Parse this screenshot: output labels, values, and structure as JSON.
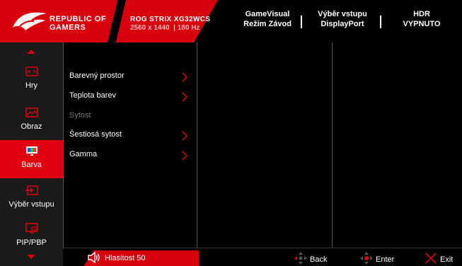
{
  "header": {
    "brand_line1": "REPUBLIC OF",
    "brand_line2": "GAMERS",
    "model": "ROG STRIX XG32WCS",
    "resolution": "2560 x 1440  | 180 Hz",
    "gamevisual_label": "GameVisual",
    "gamevisual_value": "Režim Závod",
    "input_label": "Výběr vstupu",
    "input_value": "DisplayPort",
    "hdr_label": "HDR",
    "hdr_value": "VYPNUTO"
  },
  "sidebar": {
    "items": [
      {
        "label": "Hry",
        "icon": "gamepad-icon"
      },
      {
        "label": "Obraz",
        "icon": "image-icon"
      },
      {
        "label": "Barva",
        "icon": "color-icon"
      },
      {
        "label": "Výběr vstupu",
        "icon": "input-icon"
      },
      {
        "label": "PIP/PBP",
        "icon": "pip-icon"
      }
    ],
    "active_index": 2
  },
  "menu": {
    "items": [
      {
        "label": "Barevný prostor",
        "enabled": true,
        "has_submenu": true
      },
      {
        "label": "Teplota barev",
        "enabled": true,
        "has_submenu": true
      },
      {
        "label": "Sytost",
        "enabled": false,
        "has_submenu": false
      },
      {
        "label": "Šestiosá sytost",
        "enabled": true,
        "has_submenu": true
      },
      {
        "label": "Gamma",
        "enabled": true,
        "has_submenu": true
      }
    ]
  },
  "footer": {
    "volume_label": "Hlasitost",
    "volume_value": "50",
    "back_label": "Back",
    "enter_label": "Enter",
    "exit_label": "Exit"
  },
  "colors": {
    "accent": "#e1000f",
    "background": "#000000",
    "sidebar": "#1a1a1a"
  }
}
